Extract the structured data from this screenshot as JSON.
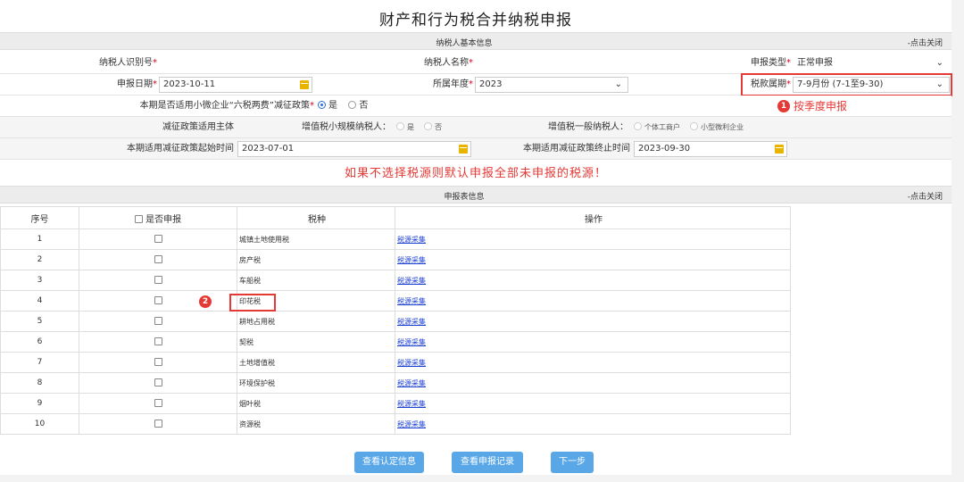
{
  "page_title": "财产和行为税合并纳税申报",
  "section1": {
    "label": "纳税人基本信息",
    "close": "-点击关闭"
  },
  "basic": {
    "taxpayer_id_label": "纳税人识别号",
    "taxpayer_name_label": "纳税人名称",
    "report_type_label": "申报类型",
    "report_type_value": "正常申报",
    "report_date_label": "申报日期",
    "report_date_value": "2023-10-11",
    "year_label": "所属年度",
    "year_value": "2023",
    "period_label": "税款属期",
    "period_value": "7-9月份 (7-1至9-30)",
    "required_mark": "*"
  },
  "policy": {
    "question": "本期是否适用小微企业“六税两费”减征政策",
    "yes": "是",
    "no": "否",
    "subject_label": "减征政策适用主体",
    "vat_small_label": "增值税小规模纳税人：",
    "vat_small_yes": "是",
    "vat_small_no": "否",
    "vat_general_label": "增值税一般纳税人：",
    "opt_individual": "个体工商户",
    "opt_small_profit": "小型微利企业",
    "start_label": "本期适用减征政策起始时间",
    "start_value": "2023-07-01",
    "end_label": "本期适用减征政策终止时间",
    "end_value": "2023-09-30"
  },
  "annotation1": {
    "badge": "1",
    "text": "按季度申报"
  },
  "annotation2": {
    "badge": "2"
  },
  "notice": "如果不选择税源则默认申报全部未申报的税源！",
  "section2": {
    "label": "申报表信息",
    "close": "-点击关闭"
  },
  "table": {
    "headers": [
      "序号",
      "是否申报",
      "税种",
      "操作"
    ],
    "rows": [
      {
        "no": "1",
        "tax": "城镇土地使用税",
        "op": "税源采集"
      },
      {
        "no": "2",
        "tax": "房产税",
        "op": "税源采集"
      },
      {
        "no": "3",
        "tax": "车船税",
        "op": "税源采集"
      },
      {
        "no": "4",
        "tax": "印花税",
        "op": "税源采集"
      },
      {
        "no": "5",
        "tax": "耕地占用税",
        "op": "税源采集"
      },
      {
        "no": "6",
        "tax": "契税",
        "op": "税源采集"
      },
      {
        "no": "7",
        "tax": "土地增值税",
        "op": "税源采集"
      },
      {
        "no": "8",
        "tax": "环境保护税",
        "op": "税源采集"
      },
      {
        "no": "9",
        "tax": "烟叶税",
        "op": "税源采集"
      },
      {
        "no": "10",
        "tax": "资源税",
        "op": "税源采集"
      }
    ]
  },
  "buttons": {
    "view_cert": "查看认定信息",
    "view_records": "查看申报记录",
    "next": "下一步"
  },
  "colors": {
    "accent_red": "#e53935",
    "button_blue": "#5aa7e8",
    "link_blue": "#1a3fd1"
  }
}
